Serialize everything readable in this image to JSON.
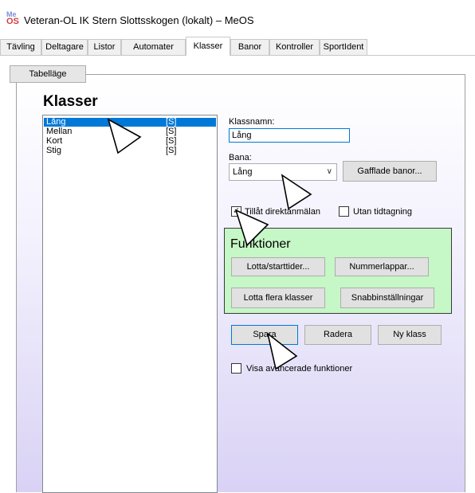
{
  "window": {
    "icon_top": "Me",
    "icon_bottom": "OS",
    "title": "Veteran-OL IK Stern Slottsskogen (lokalt) – MeOS"
  },
  "tabs": [
    {
      "label": "Tävling"
    },
    {
      "label": "Deltagare"
    },
    {
      "label": "Listor"
    },
    {
      "label": "Automater"
    },
    {
      "label": "Klasser"
    },
    {
      "label": "Banor"
    },
    {
      "label": "Kontroller"
    },
    {
      "label": "SportIdent"
    }
  ],
  "toolbar": {
    "table_mode_label": "Tabelläge"
  },
  "page": {
    "heading": "Klasser"
  },
  "class_list": [
    {
      "name": "Lång",
      "tag": "[S]"
    },
    {
      "name": "Mellan",
      "tag": "[S]"
    },
    {
      "name": "Kort",
      "tag": "[S]"
    },
    {
      "name": "Stig",
      "tag": "[S]"
    }
  ],
  "form": {
    "class_name_label": "Klassnamn:",
    "class_name_value": "Lång",
    "course_label": "Bana:",
    "course_value": "Lång",
    "forked_courses_label": "Gafflade banor...",
    "allow_direct_entry_label": "Tillåt direktanmälan",
    "allow_direct_entry_checked": true,
    "no_timing_label": "Utan tidtagning",
    "no_timing_checked": false
  },
  "functions": {
    "title": "Funktioner",
    "draw_start_times_label": "Lotta/starttider...",
    "bib_numbers_label": "Nummerlappar...",
    "draw_multiple_label": "Lotta flera klasser",
    "quick_settings_label": "Snabbinställningar"
  },
  "actions": {
    "save_label": "Spara",
    "delete_label": "Radera",
    "new_class_label": "Ny klass"
  },
  "advanced": {
    "show_advanced_label": "Visa avancerade funktioner",
    "checked": false
  },
  "colors": {
    "selection": "#0078d7",
    "functions_bg": "#c6f7c6",
    "panel_gradient_bottom": "#d9d2f5"
  }
}
